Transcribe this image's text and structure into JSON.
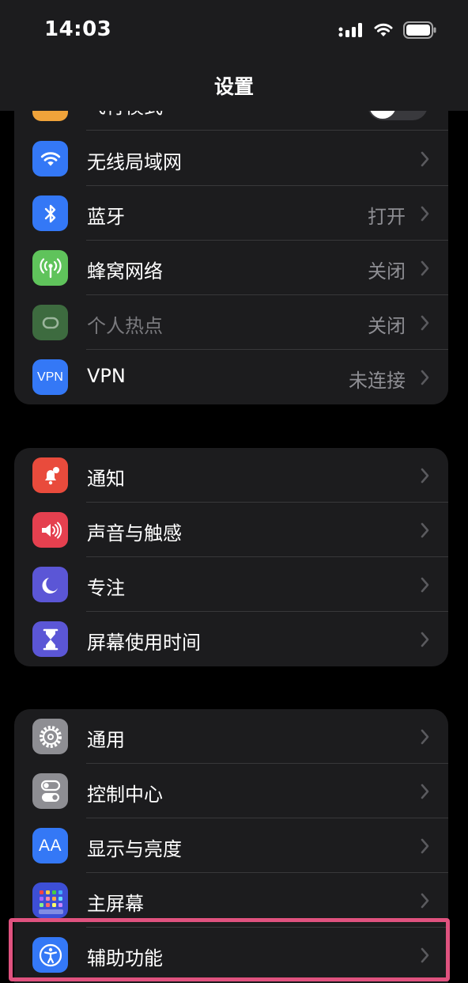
{
  "status_bar": {
    "time": "14:03"
  },
  "nav": {
    "title": "设置"
  },
  "group1": {
    "partial_label": "飞行模式",
    "items": [
      {
        "label": "无线局域网",
        "value": ""
      },
      {
        "label": "蓝牙",
        "value": "打开"
      },
      {
        "label": "蜂窝网络",
        "value": "关闭"
      },
      {
        "label": "个人热点",
        "value": "关闭"
      },
      {
        "label": "VPN",
        "value": "未连接",
        "icon_text": "VPN"
      }
    ]
  },
  "group2": {
    "items": [
      {
        "label": "通知"
      },
      {
        "label": "声音与触感"
      },
      {
        "label": "专注"
      },
      {
        "label": "屏幕使用时间"
      }
    ]
  },
  "group3": {
    "items": [
      {
        "label": "通用"
      },
      {
        "label": "控制中心"
      },
      {
        "label": "显示与亮度",
        "icon_text": "AA"
      },
      {
        "label": "主屏幕"
      },
      {
        "label": "辅助功能"
      }
    ]
  },
  "colors": {
    "wifi": "#3478f6",
    "bluetooth": "#3478f6",
    "cellular": "#5fc35b",
    "hotspot": "#3d6b3f",
    "vpn": "#3478f6",
    "notifications": "#e94b3c",
    "sounds": "#e5404f",
    "focus": "#5b56d6",
    "screen_time": "#5b56d6",
    "general": "#8e8e93",
    "control_center": "#8e8e93",
    "display": "#3478f6",
    "home_screen": "#3d4fd6",
    "accessibility": "#3478f6",
    "highlight": "#e0527f"
  }
}
